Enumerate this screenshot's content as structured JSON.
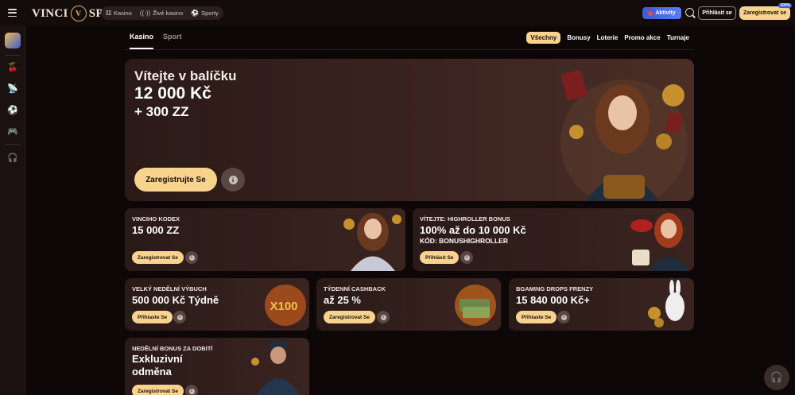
{
  "header": {
    "logo_left": "VINCI",
    "logo_mark": "V",
    "logo_right": "SPIN",
    "nav": [
      {
        "icon": "dice-icon",
        "label": "Kasino"
      },
      {
        "icon": "live-icon",
        "label": "Živé kasino"
      },
      {
        "icon": "ball-icon",
        "label": "Sporty"
      }
    ],
    "activities_label": "Aktivity",
    "login_label": "Přihlásit se",
    "register_label": "Zaregistrovat se",
    "register_badge": "100%"
  },
  "tabs": [
    {
      "label": "Kasino",
      "active": true
    },
    {
      "label": "Sport",
      "active": false
    }
  ],
  "categories": [
    {
      "label": "Všechny",
      "active": true
    },
    {
      "label": "Bonusy",
      "active": false
    },
    {
      "label": "Loterie",
      "active": false
    },
    {
      "label": "Promo akce",
      "active": false
    },
    {
      "label": "Turnaje",
      "active": false
    }
  ],
  "hero": {
    "line1": "Vítejte v balíčku",
    "line2": "12 000 Kč",
    "line3": "+ 300 ZZ",
    "button_label": "Zaregistrujte Se",
    "info_glyph": "i"
  },
  "cards": {
    "c1": {
      "title": "VINCIHO KODEX",
      "body": "15 000 ZZ",
      "button": "Zaregistrovat Se"
    },
    "c2": {
      "title": "VÍTEJTE: HIGHROLLER BONUS",
      "body": "100% až do 10 000 Kč",
      "sub": "KÓD: BONUSHIGHROLLER",
      "button": "Přihlásit Se"
    },
    "c3": {
      "title": "VELKÝ NEDĚLNÍ VÝBUCH",
      "body": "500 000 Kč Týdně",
      "button": "Přihlaste Se",
      "art_text": "X100"
    },
    "c4": {
      "title": "TÝDENNÍ CASHBACK",
      "body": "až 25 %",
      "button": "Zaregistrovat Se"
    },
    "c5": {
      "title": "BGAMING DROPS FRENZY",
      "body": "15 840 000 Kč+",
      "button": "Přihlaste Se"
    },
    "c6": {
      "title": "NEDĚLNÍ BONUS ZA DOBITÍ",
      "body1": "Exkluzivní",
      "body2": "odměna",
      "button": "Zaregistrovat Se"
    }
  },
  "colors": {
    "accent": "#f7d38d",
    "background": "#0d0807",
    "card": "#2a1a18",
    "activities": "#3b5bd8"
  }
}
